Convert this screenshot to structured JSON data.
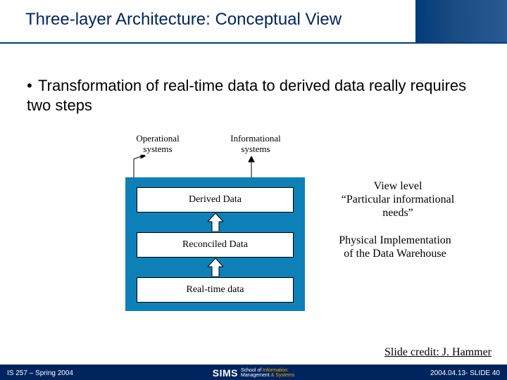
{
  "header": {
    "title": "Three-layer Architecture: Conceptual View"
  },
  "bullet": {
    "text": "Transformation of real-time data to derived data really requires two steps"
  },
  "systems": {
    "operational_l1": "Operational",
    "operational_l2": "systems",
    "informational_l1": "Informational",
    "informational_l2": "systems"
  },
  "boxes": {
    "derived": "Derived Data",
    "reconciled": "Reconciled Data",
    "realtime": "Real-time data"
  },
  "annotations": {
    "view_l1": "View level",
    "view_l2": "“Particular informational",
    "view_l3": "needs”",
    "phys_l1": "Physical Implementation",
    "phys_l2": "of the Data Warehouse"
  },
  "credit": "Slide credit: J. Hammer",
  "footer": {
    "left": "IS 257 – Spring 2004",
    "right": "2004.04.13- SLIDE 40",
    "logo_main": "SIMS",
    "logo_sub1_a": "School of ",
    "logo_sub1_b": "Information",
    "logo_sub2_a": "Management ",
    "logo_sub2_b": "& Systems"
  }
}
